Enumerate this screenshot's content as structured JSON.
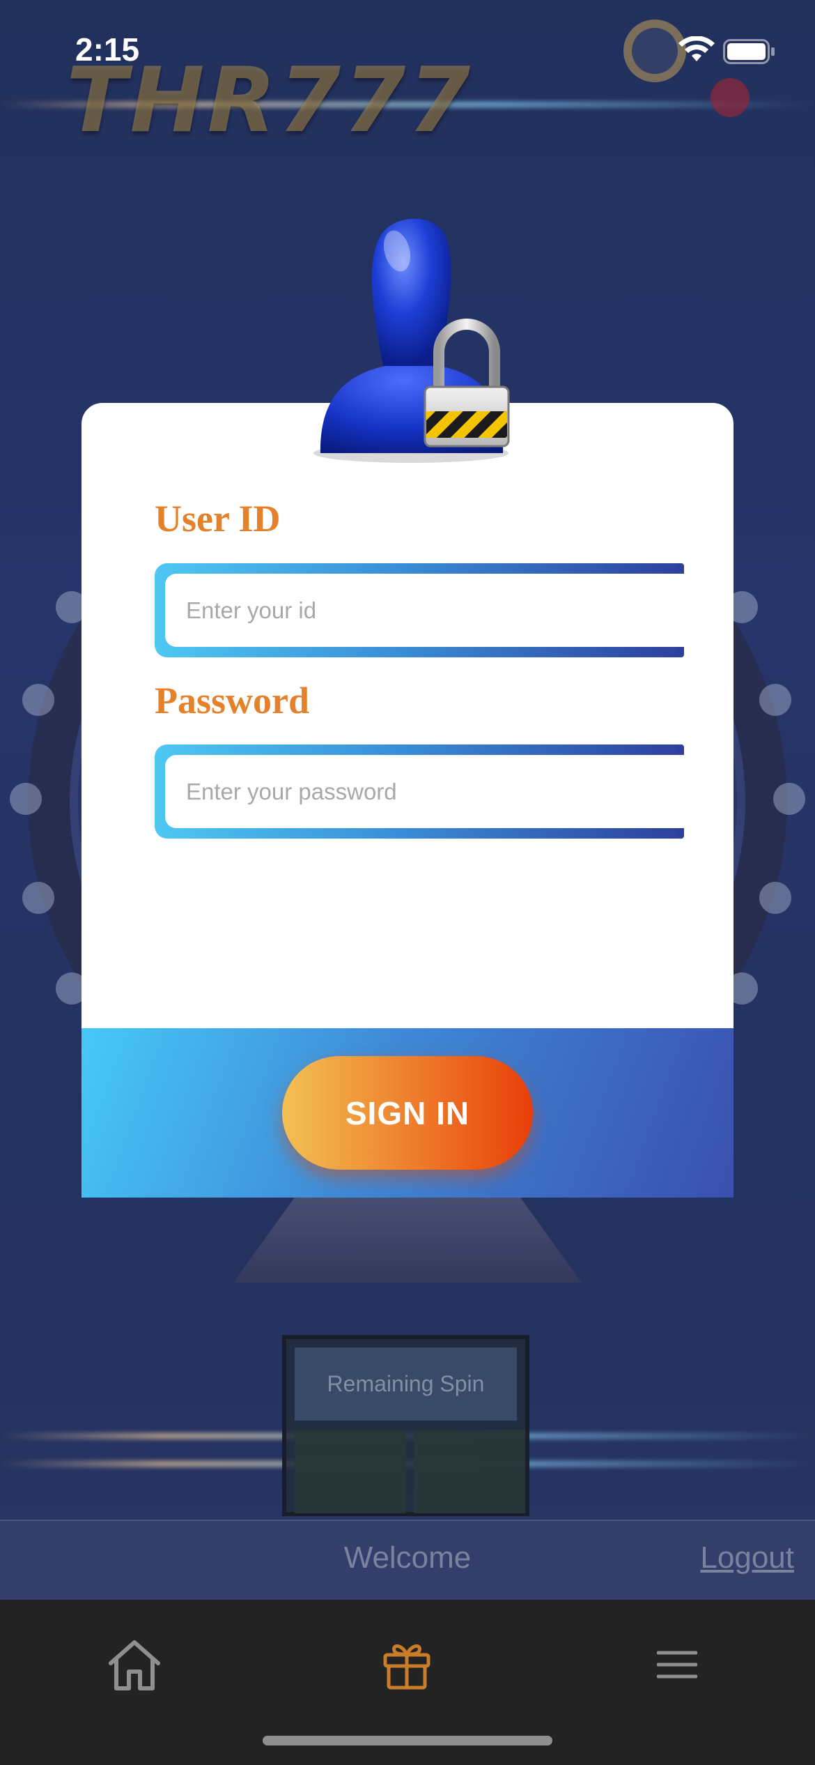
{
  "status_bar": {
    "time": "2:15"
  },
  "background": {
    "logo_text": "THR777",
    "panel_title": "Remaining Spin",
    "welcome_text": "Welcome",
    "logout_text": "Logout"
  },
  "login": {
    "user_id_label": "User ID",
    "user_id_placeholder": "Enter your id",
    "user_id_value": "",
    "password_label": "Password",
    "password_placeholder": "Enter your password",
    "password_value": "",
    "signin_label": "SIGN IN"
  },
  "tabbar": {
    "items": [
      {
        "icon": "home-icon"
      },
      {
        "icon": "gift-icon"
      },
      {
        "icon": "menu-icon"
      }
    ]
  },
  "colors": {
    "label": "#e5812a",
    "button_start": "#f2c054",
    "button_end": "#e83f08",
    "footer_start": "#46c9f7",
    "footer_end": "#3a4fb0",
    "tabbar_bg": "#232323",
    "gift_icon": "#c97c2a"
  }
}
